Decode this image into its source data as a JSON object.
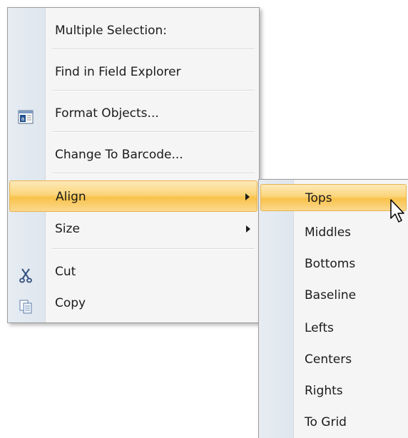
{
  "context_menu": {
    "items": [
      {
        "label": "Multiple Selection:",
        "icon": ""
      },
      {
        "label": "Find in Field Explorer",
        "icon": ""
      },
      {
        "label": "Format Objects...",
        "icon": "format-objects-icon"
      },
      {
        "label": "Change To Barcode...",
        "icon": ""
      },
      {
        "label": "Align",
        "icon": "",
        "submenu": true,
        "highlighted": true
      },
      {
        "label": "Size",
        "icon": "",
        "submenu": true
      },
      {
        "label": "Cut",
        "icon": "scissors-icon"
      },
      {
        "label": "Copy",
        "icon": "copy-icon"
      }
    ]
  },
  "align_submenu": {
    "items": [
      {
        "label": "Tops",
        "highlighted": true
      },
      {
        "label": "Middles"
      },
      {
        "label": "Bottoms"
      },
      {
        "label": "Baseline"
      },
      {
        "label": "Lefts"
      },
      {
        "label": "Centers"
      },
      {
        "label": "Rights"
      },
      {
        "label": "To Grid"
      }
    ]
  },
  "colors": {
    "highlight": "#fbd57a",
    "highlight_border": "#e8b34b",
    "menu_background": "#f5f5f5",
    "gutter": "#e3e9f0",
    "text": "#1b1b1b"
  }
}
